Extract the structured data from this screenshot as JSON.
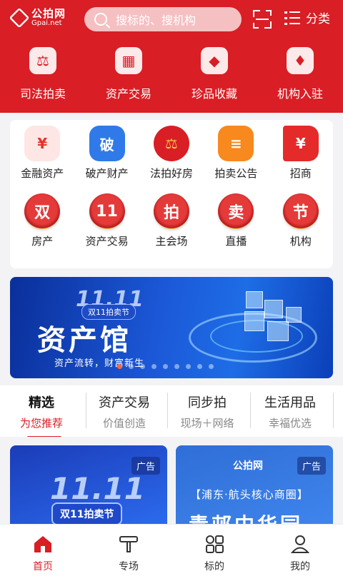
{
  "header": {
    "logo_cn": "公拍网",
    "logo_en": "Gpai.net",
    "search_placeholder": "搜标的、搜机构",
    "category_label": "分类"
  },
  "top_nav": [
    {
      "label": "司法拍卖",
      "icon": "court-emblem-icon"
    },
    {
      "label": "资产交易",
      "icon": "building-icon"
    },
    {
      "label": "珍品收藏",
      "icon": "collection-grid-icon"
    },
    {
      "label": "机构入驻",
      "icon": "diamond-icon"
    }
  ],
  "grid": [
    {
      "label": "金融资产",
      "glyph": "¥",
      "icon": "hand-money-icon"
    },
    {
      "label": "破产财产",
      "glyph": "破",
      "icon": "bankruptcy-icon"
    },
    {
      "label": "法拍好房",
      "glyph": "⚖",
      "icon": "court-emblem-icon"
    },
    {
      "label": "拍卖公告",
      "glyph": "≡",
      "icon": "notice-icon"
    },
    {
      "label": "招商",
      "glyph": "¥",
      "icon": "flag-icon"
    },
    {
      "label": "房产",
      "glyph": "双",
      "icon": "double-badge-icon"
    },
    {
      "label": "资产交易",
      "glyph": "11",
      "icon": "eleven-badge-icon"
    },
    {
      "label": "主会场",
      "glyph": "拍",
      "icon": "auction-badge-icon"
    },
    {
      "label": "直播",
      "glyph": "卖",
      "icon": "sale-badge-icon"
    },
    {
      "label": "机构",
      "glyph": "节",
      "icon": "festival-badge-icon"
    }
  ],
  "banner": {
    "top": "11.11",
    "tag": "双11拍卖节",
    "title": "资产馆",
    "subtitle": "资产流转，财富新生",
    "dot_count": 9,
    "active_dot": 0
  },
  "tabs": [
    {
      "title": "精选",
      "subtitle": "为您推荐"
    },
    {
      "title": "资产交易",
      "subtitle": "价值创造"
    },
    {
      "title": "同步拍",
      "subtitle": "现场＋网络"
    },
    {
      "title": "生活用品",
      "subtitle": "幸福优选"
    }
  ],
  "ads": [
    {
      "badge": "广告",
      "number": "11.11",
      "pill": "双11拍卖节"
    },
    {
      "badge": "广告",
      "logo": "公拍网",
      "location": "【浦东·航头核心商圈】",
      "headline": "青邨中华园"
    }
  ],
  "bottom_nav": [
    {
      "label": "首页",
      "icon": "home-icon"
    },
    {
      "label": "专场",
      "icon": "gavel-icon"
    },
    {
      "label": "标的",
      "icon": "grid-icon"
    },
    {
      "label": "我的",
      "icon": "user-icon"
    }
  ],
  "colors": {
    "brand_red": "#d91e25",
    "banner_blue": "#1b57d6"
  }
}
